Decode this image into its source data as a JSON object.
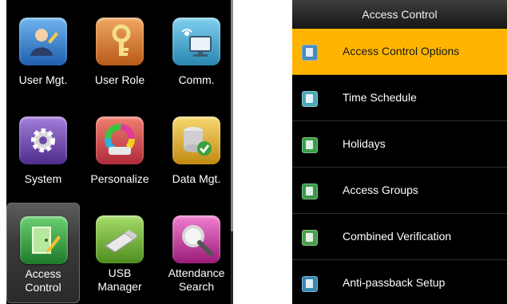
{
  "left_panel": {
    "apps": [
      {
        "label": "User Mgt.",
        "icon": "user-management-icon",
        "color": "#2f7fd4"
      },
      {
        "label": "User Role",
        "icon": "key-icon",
        "color": "#d87a2a"
      },
      {
        "label": "Comm.",
        "icon": "network-computer-icon",
        "color": "#3aa6d0"
      },
      {
        "label": "System",
        "icon": "gear-icon",
        "color": "#7a4fb8"
      },
      {
        "label": "Personalize",
        "icon": "color-wheel-icon",
        "color": "#d84a5a"
      },
      {
        "label": "Data Mgt.",
        "icon": "database-check-icon",
        "color": "#e2b62e"
      },
      {
        "label": "Access\nControl",
        "icon": "door-pencil-icon",
        "color": "#2f9a3e",
        "selected": true
      },
      {
        "label": "USB\nManager",
        "icon": "usb-drive-icon",
        "color": "#77b83a"
      },
      {
        "label": "Attendance\nSearch",
        "icon": "magnifier-icon",
        "color": "#c83a9c"
      }
    ]
  },
  "right_panel": {
    "title": "Access Control",
    "items": [
      {
        "label": "Access Control Options",
        "icon": "access-options-icon",
        "color": "#4a8ac0",
        "selected": true
      },
      {
        "label": "Time Schedule",
        "icon": "clock-icon",
        "color": "#4aa8b8"
      },
      {
        "label": "Holidays",
        "icon": "calendar-icon",
        "color": "#3aa04a"
      },
      {
        "label": "Access Groups",
        "icon": "group-icon",
        "color": "#3a9a4a"
      },
      {
        "label": "Combined Verification",
        "icon": "combined-verification-icon",
        "color": "#4aa04a"
      },
      {
        "label": "Anti-passback Setup",
        "icon": "anti-passback-icon",
        "color": "#3a88b0"
      }
    ]
  },
  "colors": {
    "accent": "#ffb400",
    "background": "#000000",
    "text": "#ffffff"
  }
}
